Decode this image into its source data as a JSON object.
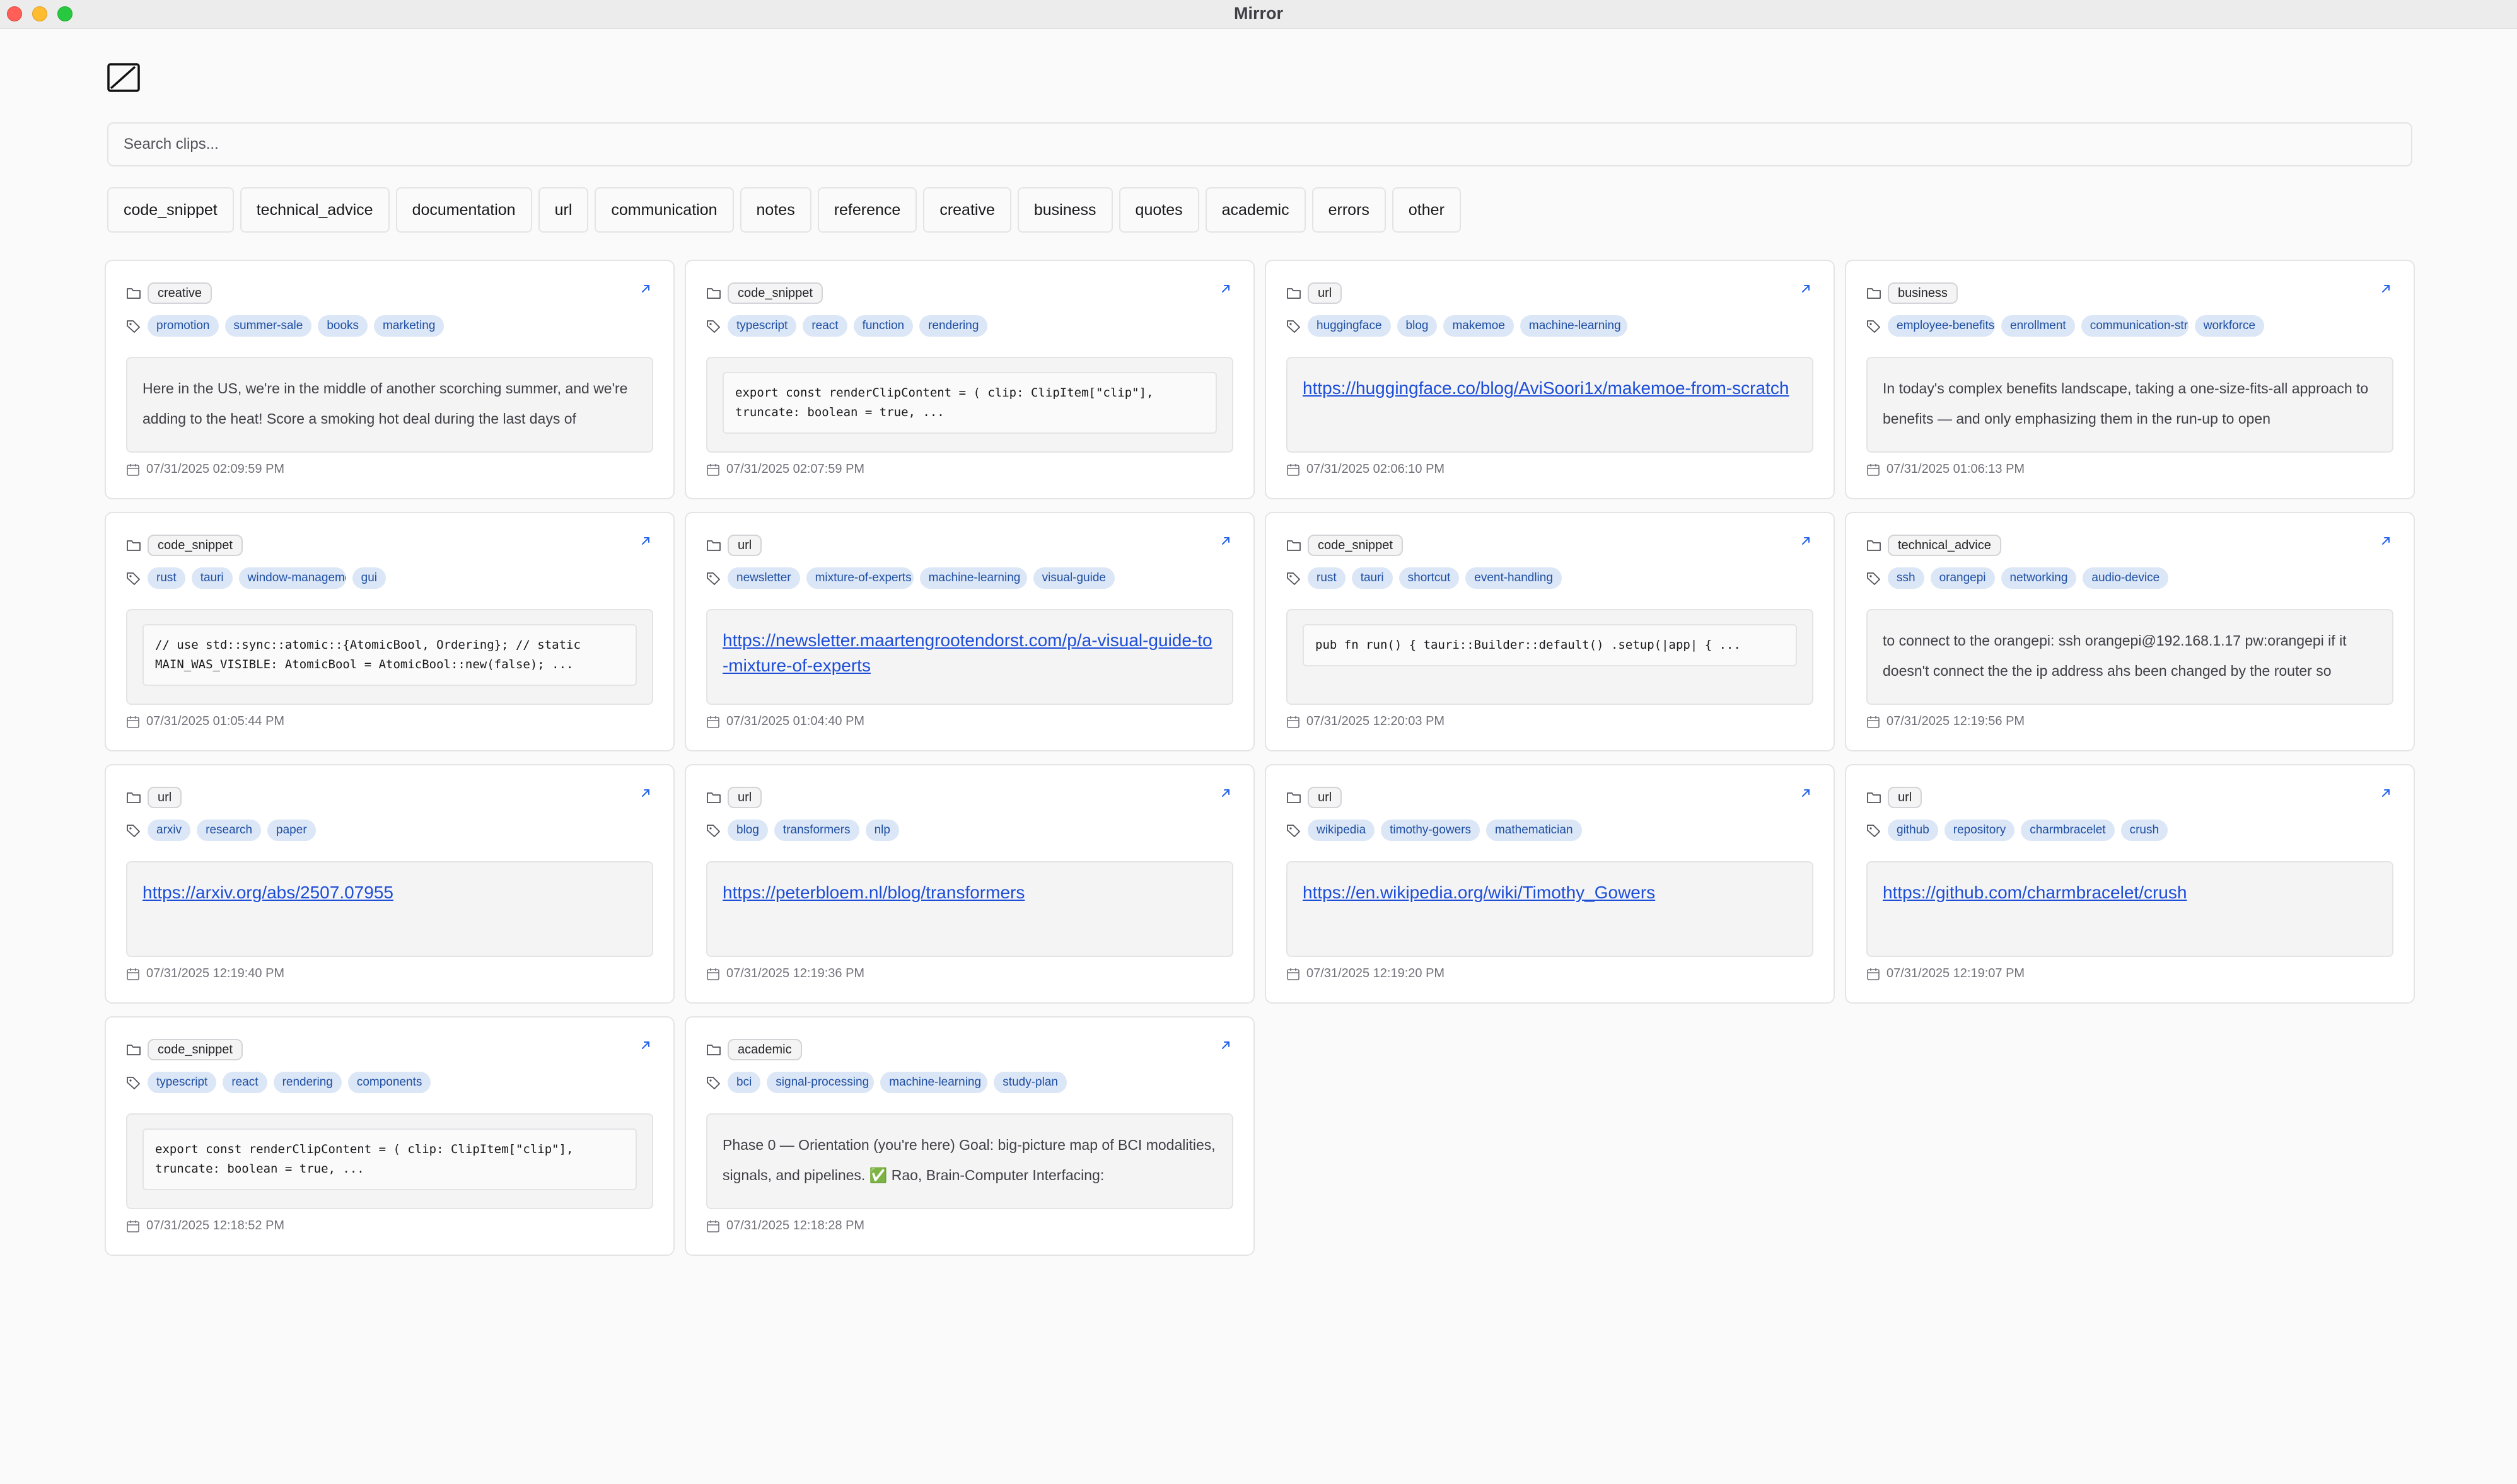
{
  "window": {
    "title": "Mirror"
  },
  "search": {
    "placeholder": "Search clips..."
  },
  "categories": [
    "code_snippet",
    "technical_advice",
    "documentation",
    "url",
    "communication",
    "notes",
    "reference",
    "creative",
    "business",
    "quotes",
    "academic",
    "errors",
    "other"
  ],
  "clips": [
    {
      "category": "creative",
      "tags": [
        "promotion",
        "summer-sale",
        "books",
        "marketing"
      ],
      "type": "text",
      "content": "Here in the US, we're in the middle of another scorching summer, and we're adding to the heat! Score a smoking hot deal during the last days of",
      "date": "07/31/2025 02:09:59 PM"
    },
    {
      "category": "code_snippet",
      "tags": [
        "typescript",
        "react",
        "function",
        "rendering"
      ],
      "type": "code",
      "content": "export const renderClipContent = ( clip: ClipItem[\"clip\"], truncate: boolean = true, ...",
      "date": "07/31/2025 02:07:59 PM"
    },
    {
      "category": "url",
      "tags": [
        "huggingface",
        "blog",
        "makemoe",
        "machine-learning"
      ],
      "type": "link",
      "content": "https://huggingface.co/blog/AviSoori1x/makemoe-from-scratch",
      "date": "07/31/2025 02:06:10 PM"
    },
    {
      "category": "business",
      "tags": [
        "employee-benefits",
        "enrollment",
        "communication-strategy",
        "workforce"
      ],
      "type": "text",
      "content": "In today's complex benefits landscape, taking a one-size-fits-all approach to benefits — and only emphasizing them in the run-up to open",
      "date": "07/31/2025 01:06:13 PM"
    },
    {
      "category": "code_snippet",
      "tags": [
        "rust",
        "tauri",
        "window-management",
        "gui"
      ],
      "type": "code",
      "content": "// use std::sync::atomic::{AtomicBool, Ordering}; // static MAIN_WAS_VISIBLE: AtomicBool = AtomicBool::new(false); ...",
      "date": "07/31/2025 01:05:44 PM"
    },
    {
      "category": "url",
      "tags": [
        "newsletter",
        "mixture-of-experts",
        "machine-learning",
        "visual-guide"
      ],
      "type": "link",
      "content": "https://newsletter.maartengrootendorst.com/p/a-visual-guide-to-mixture-of-experts",
      "date": "07/31/2025 01:04:40 PM"
    },
    {
      "category": "code_snippet",
      "tags": [
        "rust",
        "tauri",
        "shortcut",
        "event-handling"
      ],
      "type": "code",
      "content": "pub fn run() { tauri::Builder::default() .setup(|app| { ...",
      "date": "07/31/2025 12:20:03 PM"
    },
    {
      "category": "technical_advice",
      "tags": [
        "ssh",
        "orangepi",
        "networking",
        "audio-device"
      ],
      "type": "text",
      "content": "to connect to the orangepi: ssh orangepi@192.168.1.17 pw:orangepi if it doesn't connect the the ip address ahs been changed by the router so",
      "date": "07/31/2025 12:19:56 PM"
    },
    {
      "category": "url",
      "tags": [
        "arxiv",
        "research",
        "paper"
      ],
      "type": "link",
      "content": "https://arxiv.org/abs/2507.07955",
      "date": "07/31/2025 12:19:40 PM"
    },
    {
      "category": "url",
      "tags": [
        "blog",
        "transformers",
        "nlp"
      ],
      "type": "link",
      "content": "https://peterbloem.nl/blog/transformers",
      "date": "07/31/2025 12:19:36 PM"
    },
    {
      "category": "url",
      "tags": [
        "wikipedia",
        "timothy-gowers",
        "mathematician"
      ],
      "type": "link",
      "content": "https://en.wikipedia.org/wiki/Timothy_Gowers",
      "date": "07/31/2025 12:19:20 PM"
    },
    {
      "category": "url",
      "tags": [
        "github",
        "repository",
        "charmbracelet",
        "crush"
      ],
      "type": "link",
      "content": "https://github.com/charmbracelet/crush",
      "date": "07/31/2025 12:19:07 PM"
    },
    {
      "category": "code_snippet",
      "tags": [
        "typescript",
        "react",
        "rendering",
        "components"
      ],
      "type": "code",
      "content": "export const renderClipContent = ( clip: ClipItem[\"clip\"], truncate: boolean = true, ...",
      "date": "07/31/2025 12:18:52 PM"
    },
    {
      "category": "academic",
      "tags": [
        "bci",
        "signal-processing",
        "machine-learning",
        "study-plan"
      ],
      "type": "text",
      "content": "Phase 0 — Orientation (you're here) Goal: big-picture map of BCI modalities, signals, and pipelines. ✅ Rao, Brain-Computer Interfacing:",
      "date": "07/31/2025 12:18:28 PM"
    }
  ]
}
